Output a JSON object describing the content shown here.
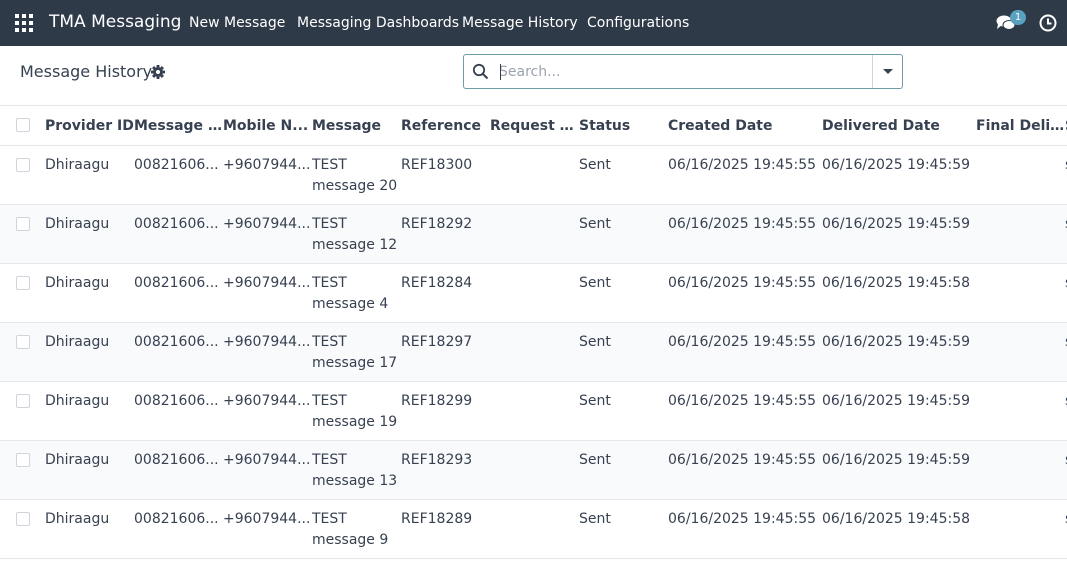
{
  "navbar": {
    "brand": "TMA Messaging",
    "menus": [
      "New Message",
      "Messaging Dashboards",
      "Message History",
      "Configurations"
    ],
    "chat_badge_count": "1"
  },
  "control_panel": {
    "title": "Message History",
    "search_placeholder": "Search..."
  },
  "table": {
    "columns": [
      "Provider ID",
      "Message ID",
      "Mobile N...",
      "Message",
      "Reference",
      "Request T...",
      "Status",
      "Created Date",
      "Delivered Date",
      "Final Deli...",
      "S"
    ],
    "rows": [
      {
        "provider": "Dhiraagu",
        "message_id": "00821606...",
        "mobile": "+9607944...",
        "message": "TEST message 20",
        "reference": "REF18300",
        "request_t": "",
        "status": "Sent",
        "created": "06/16/2025 19:45:55",
        "delivered": "06/16/2025 19:45:59",
        "final": "",
        "extra": "s"
      },
      {
        "provider": "Dhiraagu",
        "message_id": "00821606...",
        "mobile": "+9607944...",
        "message": "TEST message 12",
        "reference": "REF18292",
        "request_t": "",
        "status": "Sent",
        "created": "06/16/2025 19:45:55",
        "delivered": "06/16/2025 19:45:59",
        "final": "",
        "extra": "s"
      },
      {
        "provider": "Dhiraagu",
        "message_id": "00821606...",
        "mobile": "+9607944...",
        "message": "TEST message 4",
        "reference": "REF18284",
        "request_t": "",
        "status": "Sent",
        "created": "06/16/2025 19:45:55",
        "delivered": "06/16/2025 19:45:58",
        "final": "",
        "extra": "s"
      },
      {
        "provider": "Dhiraagu",
        "message_id": "00821606...",
        "mobile": "+9607944...",
        "message": "TEST message 17",
        "reference": "REF18297",
        "request_t": "",
        "status": "Sent",
        "created": "06/16/2025 19:45:55",
        "delivered": "06/16/2025 19:45:59",
        "final": "",
        "extra": "s"
      },
      {
        "provider": "Dhiraagu",
        "message_id": "00821606...",
        "mobile": "+9607944...",
        "message": "TEST message 19",
        "reference": "REF18299",
        "request_t": "",
        "status": "Sent",
        "created": "06/16/2025 19:45:55",
        "delivered": "06/16/2025 19:45:59",
        "final": "",
        "extra": "s"
      },
      {
        "provider": "Dhiraagu",
        "message_id": "00821606...",
        "mobile": "+9607944...",
        "message": "TEST message 13",
        "reference": "REF18293",
        "request_t": "",
        "status": "Sent",
        "created": "06/16/2025 19:45:55",
        "delivered": "06/16/2025 19:45:59",
        "final": "",
        "extra": "s"
      },
      {
        "provider": "Dhiraagu",
        "message_id": "00821606...",
        "mobile": "+9607944...",
        "message": "TEST message 9",
        "reference": "REF18289",
        "request_t": "",
        "status": "Sent",
        "created": "06/16/2025 19:45:55",
        "delivered": "06/16/2025 19:45:58",
        "final": "",
        "extra": "s"
      }
    ]
  },
  "icons": {
    "apps": "grid-icon",
    "chat": "chat-bubbles-icon",
    "activity": "clock-icon",
    "settings": "gear-icon",
    "search": "search-icon",
    "dropdown": "caret-down-icon"
  },
  "colors": {
    "navbar_bg": "#2e3a47",
    "badge_bg": "#5aa1c0",
    "search_border": "#6b9ea6"
  }
}
